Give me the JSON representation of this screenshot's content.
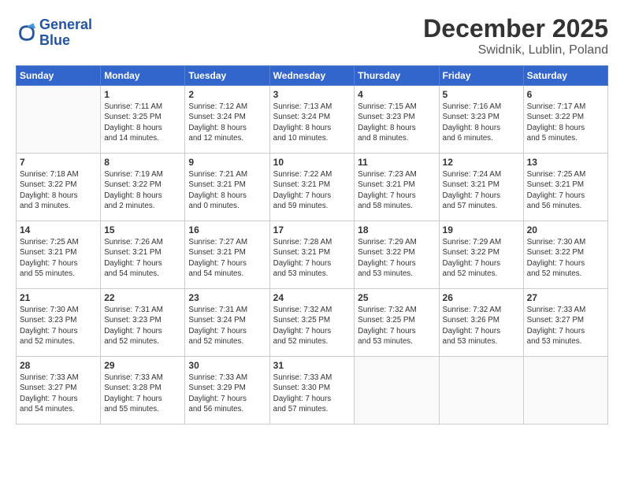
{
  "logo": {
    "line1": "General",
    "line2": "Blue"
  },
  "header": {
    "month": "December 2025",
    "location": "Swidnik, Lublin, Poland"
  },
  "weekdays": [
    "Sunday",
    "Monday",
    "Tuesday",
    "Wednesday",
    "Thursday",
    "Friday",
    "Saturday"
  ],
  "weeks": [
    [
      {
        "day": "",
        "info": ""
      },
      {
        "day": "1",
        "info": "Sunrise: 7:11 AM\nSunset: 3:25 PM\nDaylight: 8 hours\nand 14 minutes."
      },
      {
        "day": "2",
        "info": "Sunrise: 7:12 AM\nSunset: 3:24 PM\nDaylight: 8 hours\nand 12 minutes."
      },
      {
        "day": "3",
        "info": "Sunrise: 7:13 AM\nSunset: 3:24 PM\nDaylight: 8 hours\nand 10 minutes."
      },
      {
        "day": "4",
        "info": "Sunrise: 7:15 AM\nSunset: 3:23 PM\nDaylight: 8 hours\nand 8 minutes."
      },
      {
        "day": "5",
        "info": "Sunrise: 7:16 AM\nSunset: 3:23 PM\nDaylight: 8 hours\nand 6 minutes."
      },
      {
        "day": "6",
        "info": "Sunrise: 7:17 AM\nSunset: 3:22 PM\nDaylight: 8 hours\nand 5 minutes."
      }
    ],
    [
      {
        "day": "7",
        "info": "Sunrise: 7:18 AM\nSunset: 3:22 PM\nDaylight: 8 hours\nand 3 minutes."
      },
      {
        "day": "8",
        "info": "Sunrise: 7:19 AM\nSunset: 3:22 PM\nDaylight: 8 hours\nand 2 minutes."
      },
      {
        "day": "9",
        "info": "Sunrise: 7:21 AM\nSunset: 3:21 PM\nDaylight: 8 hours\nand 0 minutes."
      },
      {
        "day": "10",
        "info": "Sunrise: 7:22 AM\nSunset: 3:21 PM\nDaylight: 7 hours\nand 59 minutes."
      },
      {
        "day": "11",
        "info": "Sunrise: 7:23 AM\nSunset: 3:21 PM\nDaylight: 7 hours\nand 58 minutes."
      },
      {
        "day": "12",
        "info": "Sunrise: 7:24 AM\nSunset: 3:21 PM\nDaylight: 7 hours\nand 57 minutes."
      },
      {
        "day": "13",
        "info": "Sunrise: 7:25 AM\nSunset: 3:21 PM\nDaylight: 7 hours\nand 56 minutes."
      }
    ],
    [
      {
        "day": "14",
        "info": "Sunrise: 7:25 AM\nSunset: 3:21 PM\nDaylight: 7 hours\nand 55 minutes."
      },
      {
        "day": "15",
        "info": "Sunrise: 7:26 AM\nSunset: 3:21 PM\nDaylight: 7 hours\nand 54 minutes."
      },
      {
        "day": "16",
        "info": "Sunrise: 7:27 AM\nSunset: 3:21 PM\nDaylight: 7 hours\nand 54 minutes."
      },
      {
        "day": "17",
        "info": "Sunrise: 7:28 AM\nSunset: 3:21 PM\nDaylight: 7 hours\nand 53 minutes."
      },
      {
        "day": "18",
        "info": "Sunrise: 7:29 AM\nSunset: 3:22 PM\nDaylight: 7 hours\nand 53 minutes."
      },
      {
        "day": "19",
        "info": "Sunrise: 7:29 AM\nSunset: 3:22 PM\nDaylight: 7 hours\nand 52 minutes."
      },
      {
        "day": "20",
        "info": "Sunrise: 7:30 AM\nSunset: 3:22 PM\nDaylight: 7 hours\nand 52 minutes."
      }
    ],
    [
      {
        "day": "21",
        "info": "Sunrise: 7:30 AM\nSunset: 3:23 PM\nDaylight: 7 hours\nand 52 minutes."
      },
      {
        "day": "22",
        "info": "Sunrise: 7:31 AM\nSunset: 3:23 PM\nDaylight: 7 hours\nand 52 minutes."
      },
      {
        "day": "23",
        "info": "Sunrise: 7:31 AM\nSunset: 3:24 PM\nDaylight: 7 hours\nand 52 minutes."
      },
      {
        "day": "24",
        "info": "Sunrise: 7:32 AM\nSunset: 3:25 PM\nDaylight: 7 hours\nand 52 minutes."
      },
      {
        "day": "25",
        "info": "Sunrise: 7:32 AM\nSunset: 3:25 PM\nDaylight: 7 hours\nand 53 minutes."
      },
      {
        "day": "26",
        "info": "Sunrise: 7:32 AM\nSunset: 3:26 PM\nDaylight: 7 hours\nand 53 minutes."
      },
      {
        "day": "27",
        "info": "Sunrise: 7:33 AM\nSunset: 3:27 PM\nDaylight: 7 hours\nand 53 minutes."
      }
    ],
    [
      {
        "day": "28",
        "info": "Sunrise: 7:33 AM\nSunset: 3:27 PM\nDaylight: 7 hours\nand 54 minutes."
      },
      {
        "day": "29",
        "info": "Sunrise: 7:33 AM\nSunset: 3:28 PM\nDaylight: 7 hours\nand 55 minutes."
      },
      {
        "day": "30",
        "info": "Sunrise: 7:33 AM\nSunset: 3:29 PM\nDaylight: 7 hours\nand 56 minutes."
      },
      {
        "day": "31",
        "info": "Sunrise: 7:33 AM\nSunset: 3:30 PM\nDaylight: 7 hours\nand 57 minutes."
      },
      {
        "day": "",
        "info": ""
      },
      {
        "day": "",
        "info": ""
      },
      {
        "day": "",
        "info": ""
      }
    ]
  ]
}
